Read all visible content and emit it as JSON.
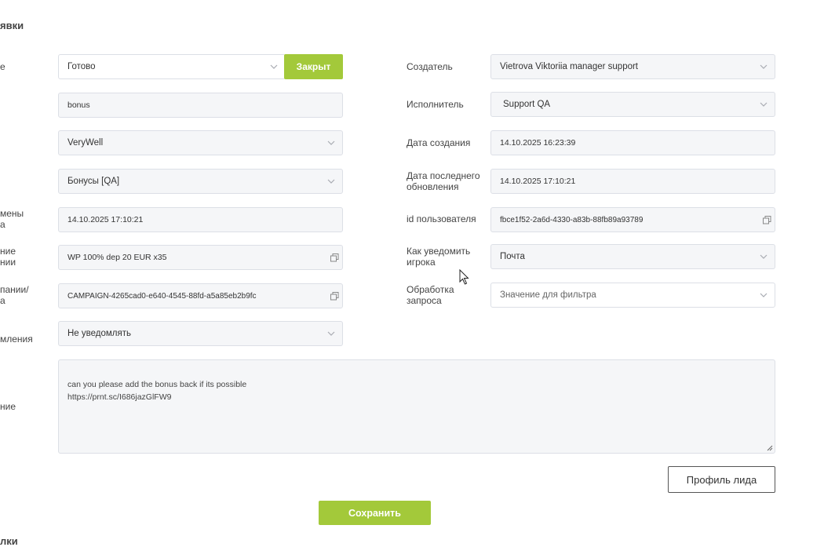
{
  "section_title": "явки",
  "bottom_section_title": "лки",
  "left_labels": {
    "status": "е",
    "change_date": "мены\nа",
    "bonus_name": "ние\nнии",
    "campaign_id": "пании/\nа",
    "notify": "мления",
    "comment": "ние"
  },
  "left_fields": {
    "status": "Готово",
    "close_button": "Закрыт",
    "tag": "bonus",
    "brand": "VeryWell",
    "category": "Бонусы [QA]",
    "change_date": "14.10.2025 17:10:21",
    "bonus_name": "WP 100% dep 20 EUR x35",
    "campaign_id": "CAMPAIGN-4265cad0-e640-4545-88fd-a5a85eb2b9fc",
    "notify": "Не уведомлять"
  },
  "right_labels": {
    "creator": "Создатель",
    "executor": "Исполнитель",
    "created": "Дата создания",
    "updated": "Дата последнего\nобновления",
    "user_id": "id пользователя",
    "notify_player": "Как уведомить\nигрока",
    "processing": "Обработка\nзапроса"
  },
  "right_fields": {
    "creator": "Vietrova Viktoriia manager support",
    "executor": "Support QA",
    "created": "14.10.2025 16:23:39",
    "updated": "14.10.2025 17:10:21",
    "user_id": "fbce1f52-2a6d-4330-a83b-88fb89a93789",
    "notify_player": "Почта",
    "processing_placeholder": "Значение для фильтра"
  },
  "comment_text": "can you please add the bonus back if its possible\nhttps://prnt.sc/I686jazGlFW9",
  "buttons": {
    "lead_profile": "Профиль лида",
    "save": "Сохранить"
  }
}
